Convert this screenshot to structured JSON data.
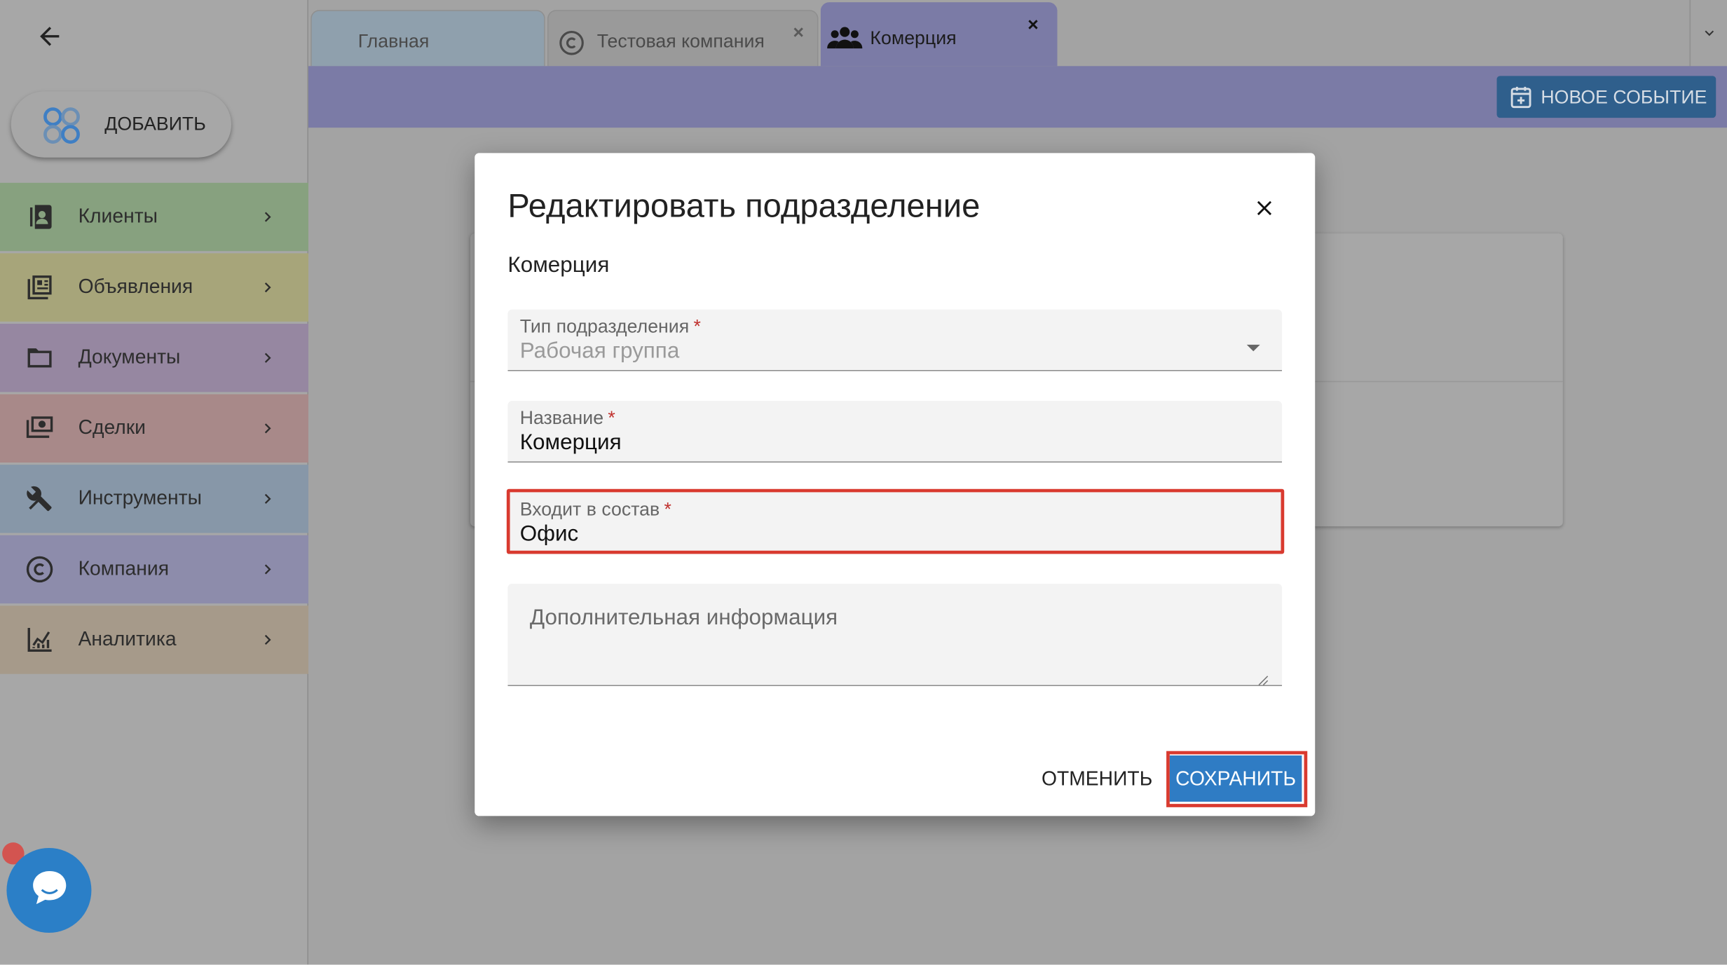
{
  "sidebar": {
    "add_label": "ДОБАВИТЬ",
    "items": [
      {
        "label": "Клиенты",
        "icon": "contacts-icon",
        "color": "#87a17f"
      },
      {
        "label": "Объявления",
        "icon": "listings-icon",
        "color": "#a7a57a"
      },
      {
        "label": "Документы",
        "icon": "folder-icon",
        "color": "#9687a1"
      },
      {
        "label": "Сделки",
        "icon": "money-icon",
        "color": "#a88989"
      },
      {
        "label": "Инструменты",
        "icon": "tools-icon",
        "color": "#8797a8"
      },
      {
        "label": "Компания",
        "icon": "copyright-icon",
        "color": "#8d8cab"
      },
      {
        "label": "Аналитика",
        "icon": "analytics-icon",
        "color": "#a69a8a"
      }
    ]
  },
  "tabs": {
    "home": "Главная",
    "company": "Тестовая компания",
    "commerce": "Комерция",
    "close": "×"
  },
  "toolbar": {
    "new_event": "НОВОЕ СОБЫТИЕ"
  },
  "dialog": {
    "title": "Редактировать подразделение",
    "subtitle": "Комерция",
    "fields": {
      "type": {
        "label": "Тип подразделения",
        "value": "Рабочая группа"
      },
      "name": {
        "label": "Название",
        "value": "Комерция"
      },
      "part_of": {
        "label": "Входит в состав",
        "value": "Офис"
      },
      "info": {
        "placeholder": "Дополнительная информация"
      }
    },
    "required_mark": "*",
    "cancel": "ОТМЕНИТЬ",
    "save": "СОХРАНИТЬ"
  },
  "colors": {
    "accent": "#2f7cc4",
    "highlight": "#d93a2f",
    "tab_active": "#7b7ba6"
  }
}
